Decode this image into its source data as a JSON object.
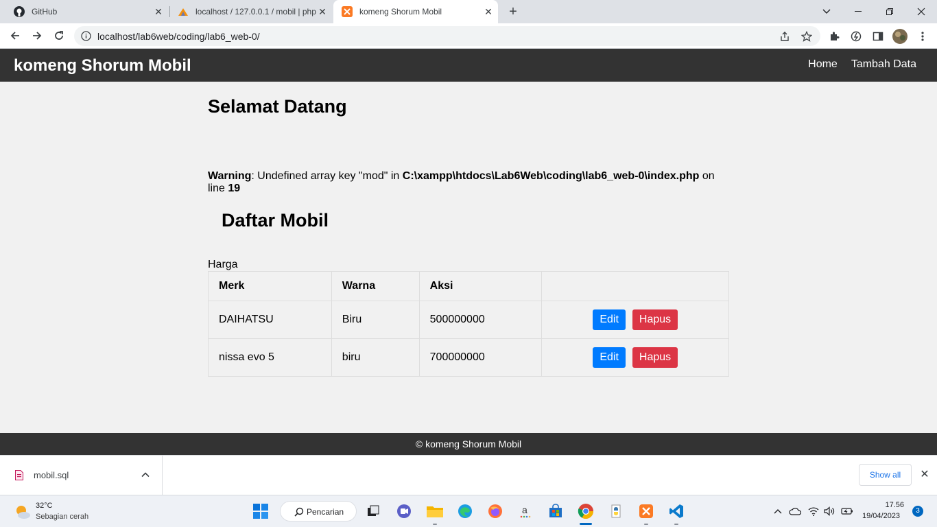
{
  "browser": {
    "tabs": [
      {
        "title": "GitHub",
        "icon": "github-icon"
      },
      {
        "title": "localhost / 127.0.0.1 / mobil | php",
        "icon": "phpmyadmin-icon"
      },
      {
        "title": "komeng Shorum Mobil",
        "icon": "xampp-icon",
        "active": true
      }
    ],
    "url": "localhost/lab6web/coding/lab6_web-0/"
  },
  "site": {
    "brand": "komeng Shorum Mobil",
    "nav": {
      "home": "Home",
      "add": "Tambah Data"
    },
    "welcome": "Selamat Datang",
    "warning": {
      "label": "Warning",
      "message": ": Undefined array key \"mod\" in ",
      "path": "C:\\xampp\\htdocs\\Lab6Web\\coding\\lab6_web-0\\index.php",
      "on_line": " on line ",
      "line": "19"
    },
    "list_title": "Daftar Mobil",
    "harga_label": "Harga",
    "table": {
      "headers": [
        "Merk",
        "Warna",
        "Aksi",
        ""
      ],
      "rows": [
        {
          "merk": "DAIHATSU",
          "warna": "Biru",
          "harga": "500000000"
        },
        {
          "merk": "nissa evo 5",
          "warna": "biru",
          "harga": "700000000"
        }
      ],
      "edit_label": "Edit",
      "delete_label": "Hapus"
    },
    "footer": "© komeng Shorum Mobil"
  },
  "downloads": {
    "file": "mobil.sql",
    "show_all": "Show all"
  },
  "taskbar": {
    "weather_temp": "32°C",
    "weather_desc": "Sebagian cerah",
    "search": "Pencarian",
    "time": "17.56",
    "date": "19/04/2023",
    "notifications": "3"
  },
  "colors": {
    "header_bg": "#333333",
    "edit_btn": "#007bff",
    "delete_btn": "#dc3545",
    "page_bg": "#f1f1f1"
  }
}
